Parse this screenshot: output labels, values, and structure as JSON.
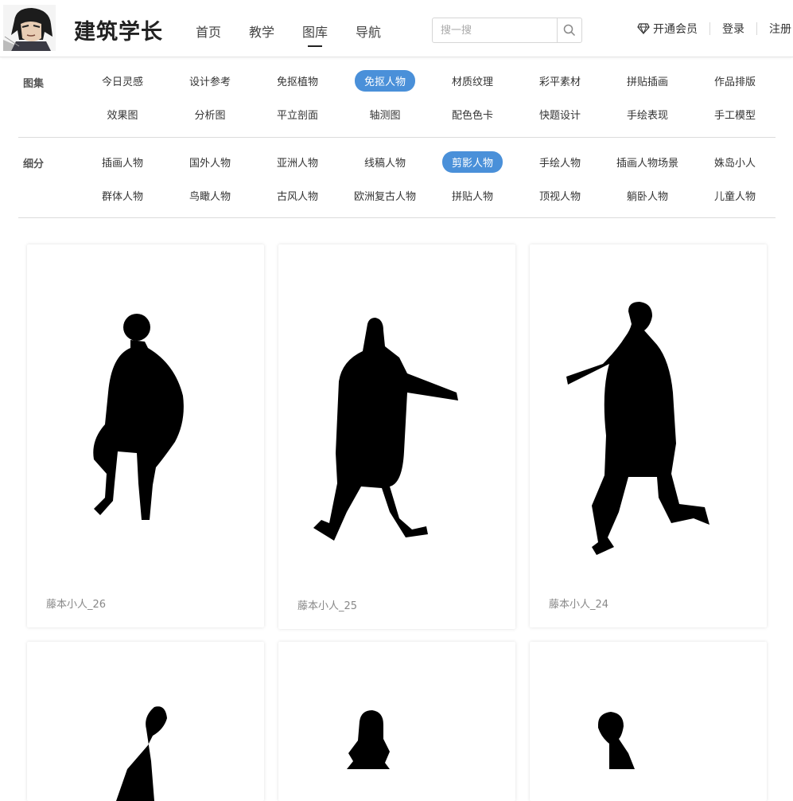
{
  "header": {
    "logo_text": "建筑学长",
    "nav": [
      "首页",
      "教学",
      "图库",
      "导航"
    ],
    "active_nav": 2,
    "search": {
      "placeholder": "搜一搜"
    },
    "vip_label": "开通会员",
    "login_label": "登录",
    "register_label": "注册"
  },
  "filters": {
    "gallery": {
      "label": "图集",
      "tags": [
        "今日灵感",
        "设计参考",
        "免抠植物",
        "免抠人物",
        "材质纹理",
        "彩平素材",
        "拼贴插画",
        "作品排版",
        "效果图",
        "分析图",
        "平立剖面",
        "轴测图",
        "配色色卡",
        "快题设计",
        "手绘表现",
        "手工模型"
      ],
      "active": 3
    },
    "subcategory": {
      "label": "细分",
      "tags": [
        "插画人物",
        "国外人物",
        "亚洲人物",
        "线稿人物",
        "剪影人物",
        "手绘人物",
        "插画人物场景",
        "姝岛小人",
        "群体人物",
        "鸟瞰人物",
        "古风人物",
        "欧洲复古人物",
        "拼贴人物",
        "顶视人物",
        "躺卧人物",
        "儿童人物"
      ],
      "active": 4
    }
  },
  "cards": [
    {
      "title": "藤本小人_26"
    },
    {
      "title": "藤本小人_25"
    },
    {
      "title": "藤本小人_24"
    },
    {
      "title": ""
    },
    {
      "title": ""
    },
    {
      "title": ""
    }
  ],
  "colors": {
    "accent": "#4a90d9",
    "silhouette": "#000000"
  }
}
